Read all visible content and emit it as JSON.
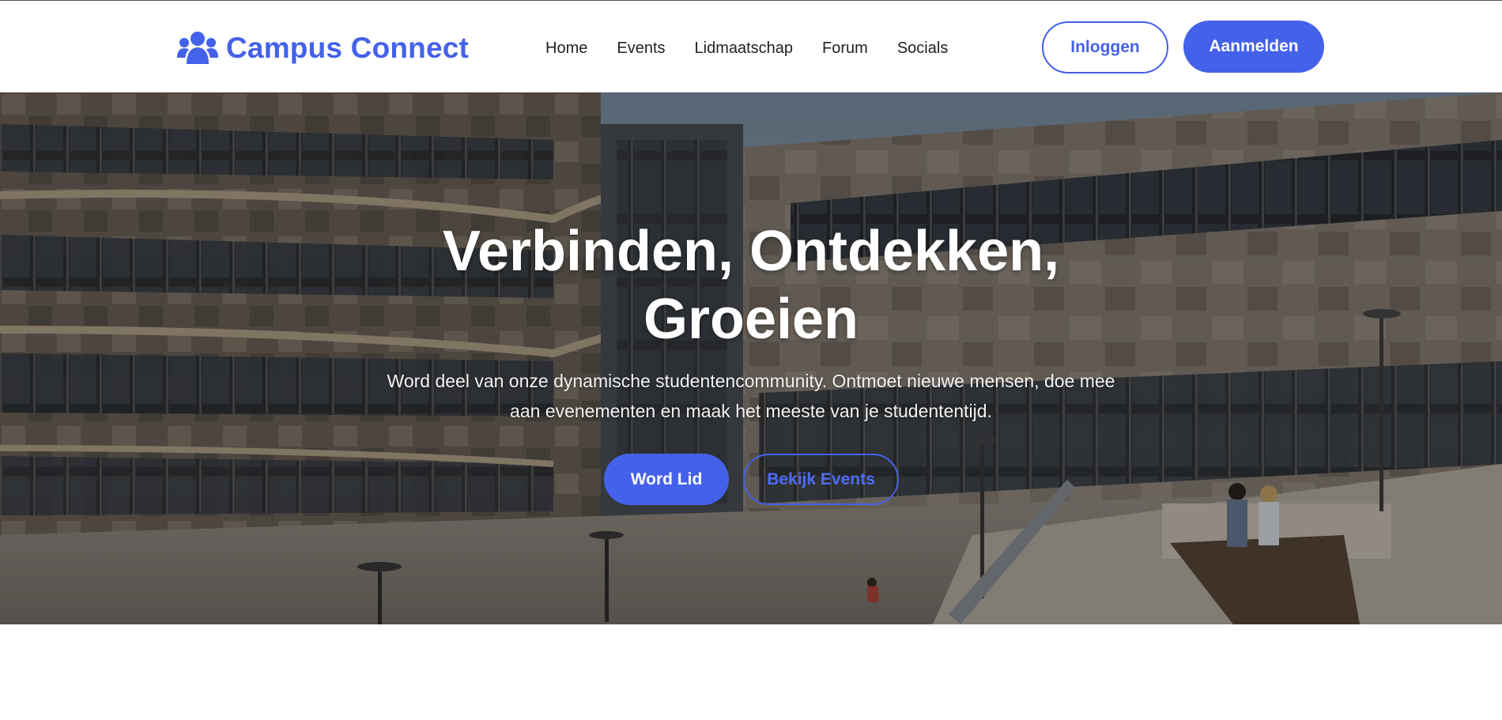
{
  "brand": {
    "name": "Campus Connect",
    "icon": "users-icon",
    "color": "#4461ea"
  },
  "nav": {
    "items": [
      {
        "label": "Home"
      },
      {
        "label": "Events"
      },
      {
        "label": "Lidmaatschap"
      },
      {
        "label": "Forum"
      },
      {
        "label": "Socials"
      }
    ]
  },
  "auth": {
    "login_label": "Inloggen",
    "signup_label": "Aanmelden"
  },
  "hero": {
    "title_line1": "Verbinden, Ontdekken,",
    "title_line2": "Groeien",
    "subtitle_line1": "Word deel van onze dynamische studentencommunity. Ontmoet nieuwe mensen, doe mee",
    "subtitle_line2": "aan evenementen en maak het meeste van je studententijd.",
    "primary_cta": "Word Lid",
    "secondary_cta": "Bekijk Events",
    "background": "campus-building-photo"
  },
  "colors": {
    "accent": "#4461ea",
    "text_dark": "#222222",
    "white": "#ffffff"
  }
}
